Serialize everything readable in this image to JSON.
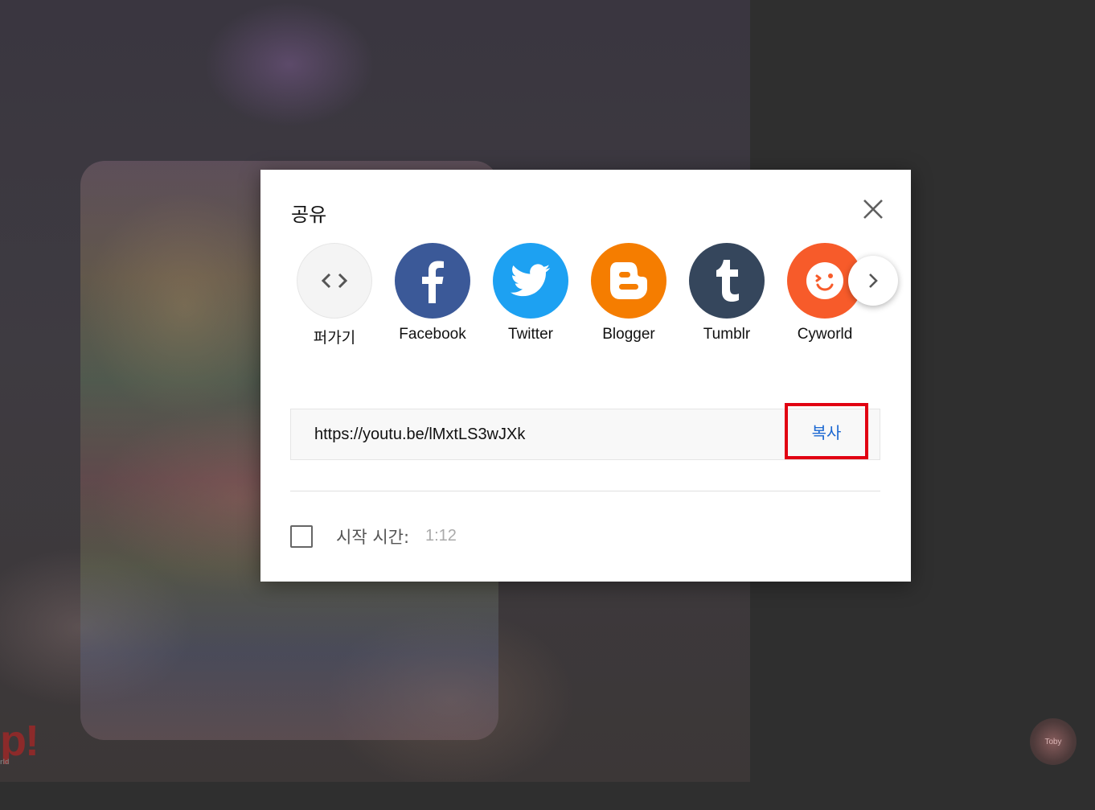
{
  "dialog": {
    "title": "공유",
    "share_targets": [
      {
        "label": "퍼가기",
        "icon": "embed-icon",
        "color": "#f4f4f4"
      },
      {
        "label": "Facebook",
        "icon": "facebook-icon",
        "color": "#3b5998"
      },
      {
        "label": "Twitter",
        "icon": "twitter-icon",
        "color": "#1da1f2"
      },
      {
        "label": "Blogger",
        "icon": "blogger-icon",
        "color": "#f57d00"
      },
      {
        "label": "Tumblr",
        "icon": "tumblr-icon",
        "color": "#35465c"
      },
      {
        "label": "Cyworld",
        "icon": "cyworld-icon",
        "color": "#f75b2a"
      }
    ],
    "url": "https://youtu.be/lMxtLS3wJXk",
    "copy_label": "복사",
    "start_time_label": "시작 시간:",
    "start_time_value": "1:12",
    "start_time_checked": false
  },
  "backdrop": {
    "brand_text": "p!",
    "brand_sub": "rld",
    "watermark_text": "Toby"
  },
  "colors": {
    "copy_highlight": "#e10012",
    "copy_text": "#1a67d2"
  }
}
